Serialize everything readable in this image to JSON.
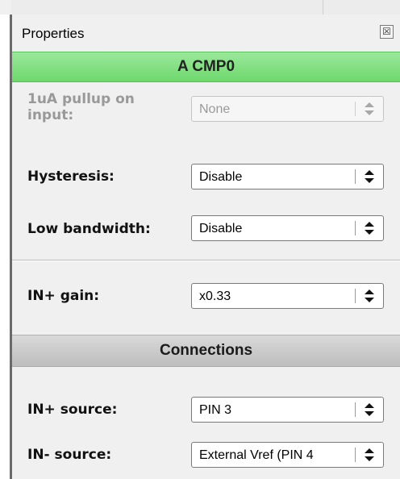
{
  "panel": {
    "title": "Properties",
    "close_glyph": "☒"
  },
  "block_header": "A CMP0",
  "connections_header": "Connections",
  "rows": {
    "pullup": {
      "label_line1": "1uA pullup on",
      "label_line2": "input:",
      "value": "None",
      "enabled": false
    },
    "hysteresis": {
      "label": "Hysteresis:",
      "value": "Disable",
      "enabled": true
    },
    "low_bandwidth": {
      "label": "Low bandwidth:",
      "value": "Disable",
      "enabled": true
    },
    "in_plus_gain": {
      "label": "IN+ gain:",
      "value": "x0.33",
      "enabled": true
    },
    "in_plus_source": {
      "label": "IN+ source:",
      "value": "PIN 3",
      "enabled": true
    },
    "in_minus_source": {
      "label": "IN- source:",
      "value": "External Vref (PIN 4",
      "enabled": true
    }
  },
  "colors": {
    "header_green": "#7ddc7c",
    "header_gray": "#c8c8c8",
    "panel_bg": "#f0f0f0"
  },
  "icons": {
    "combo_arrows": "up-down-arrows-icon",
    "close": "close-icon"
  }
}
